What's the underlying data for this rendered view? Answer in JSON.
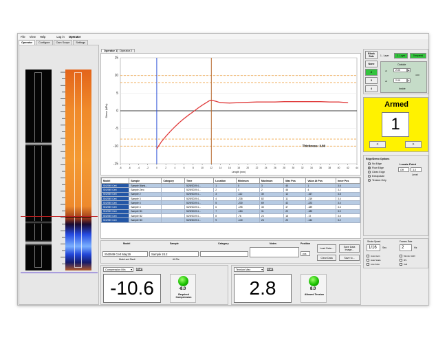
{
  "menu": [
    "File",
    "View",
    "Help",
    "Log in",
    "Operator"
  ],
  "tabs": [
    "Operator",
    "Configure",
    "Cam Scope",
    "Settings"
  ],
  "chart_tabs": [
    "Operator 1",
    "Operator 2"
  ],
  "chart_data": {
    "type": "line",
    "x_ticks": [
      "-8",
      "-6",
      "-4",
      "-2",
      "0",
      "2",
      "4",
      "6",
      "8",
      "10",
      "12",
      "14",
      "16",
      "18",
      "20",
      "22",
      "24",
      "26",
      "28",
      "30",
      "32",
      "34",
      "36",
      "38",
      "40",
      "42",
      "44"
    ],
    "y_ticks": [
      "15",
      "10",
      "5",
      "0",
      "-5",
      "-10",
      "-15"
    ],
    "xlim": [
      -8,
      44
    ],
    "ylim": [
      -15,
      15
    ],
    "ylabel": "Stress (MPa)",
    "xlabel": "Length (mm)",
    "annotation": "Thickness: 3.80",
    "series": [
      {
        "x": [
          0,
          1,
          2,
          3,
          4,
          5,
          6,
          7,
          8,
          9,
          10,
          11,
          11.5,
          12,
          13,
          14,
          16,
          18,
          20,
          22,
          24,
          26,
          28,
          30,
          32,
          34,
          36,
          38,
          40,
          42
        ],
        "y": [
          -10.8,
          -8.8,
          -7.2,
          -5.8,
          -4.5,
          -3.3,
          -2.2,
          -1.2,
          -0.3,
          0.7,
          1.6,
          2.4,
          2.8,
          3.0,
          2.7,
          2.3,
          2.2,
          2.3,
          2.4,
          2.5,
          2.5,
          2.5,
          2.6,
          2.6,
          2.6,
          2.6,
          2.6,
          2.5,
          2.5,
          2.3
        ]
      }
    ],
    "vlines": [
      {
        "x": 0,
        "color": "#2b4fd6"
      },
      {
        "x": 12,
        "color": "#b5672a"
      }
    ],
    "hlines_dashed": [
      {
        "y": 8,
        "color": "#f0a64a"
      },
      {
        "y": 10,
        "color": "#f0a64a"
      },
      {
        "y": -8,
        "color": "#f0a64a"
      },
      {
        "y": -10,
        "color": "#f0a64a"
      }
    ],
    "hline_zero": {
      "y": 0,
      "color": "#000000"
    },
    "line_color": "#e03b3b"
  },
  "table": {
    "columns": [
      "Model",
      "Sample",
      "Category",
      "Time",
      "Location",
      "Minimum",
      "Maximum",
      "Max Pos",
      "Value At Pos",
      "Inner Pos"
    ],
    "rows": [
      [
        "SN2949 Cert",
        "Sample Blank...",
        "",
        "5/29/2019 4...",
        "1",
        "0",
        "3",
        "40",
        "1",
        "3.6"
      ],
      [
        "SN2949 Cert",
        "Sample Zero",
        "",
        "5/29/2019 4...",
        "2",
        "4",
        "2",
        "46",
        "4",
        "3.2"
      ],
      [
        "SN2949 Cert",
        "Sample 2",
        "",
        "5/29/2019 4...",
        "3",
        "-112",
        "30",
        "12",
        "-167",
        "3.8"
      ],
      [
        "SN2949 Cert",
        "Sample 3",
        "",
        "5/29/2019 4...",
        "4",
        "-235",
        "82",
        "11",
        "-219",
        "3.4"
      ],
      [
        "SN2949 Cert",
        "Sample 4",
        "",
        "5/29/2019 4...",
        "5",
        "-230",
        "69",
        "42",
        "-223",
        "3.4"
      ],
      [
        "SN2949 Cert",
        "Sample 4",
        "",
        "5/29/2019 4...",
        "6",
        "-195",
        "35",
        "47",
        "-189",
        "3.3"
      ],
      [
        "SN2949 Cert",
        "Sample B1",
        "",
        "5/29/2019 4...",
        "7",
        "-184",
        "31",
        "22",
        "-180",
        "3.0"
      ],
      [
        "SN2949 Cert",
        "Sample B2",
        "",
        "5/29/2019 4...",
        "8",
        "-76",
        "23",
        "18",
        "-72",
        "3.8"
      ],
      [
        "SN2949 Cert",
        "Sample B3",
        "",
        "5/29/2019 4...",
        "9",
        "-140",
        "26",
        "20",
        "-142",
        "3.2"
      ]
    ]
  },
  "entry": {
    "headers": [
      "Model",
      "Sample",
      "Category",
      "Notes",
      "Position"
    ],
    "model_value": "SN2949 Cert May19",
    "sample_value": "Sample 24.2",
    "sub_labels": [
      "Model and Sizeit",
      "Alt File"
    ],
    "position_value": "pos",
    "buttons": [
      "Load Data...",
      "Save Data Image...",
      "Clear Data",
      "Save to..."
    ]
  },
  "compression": {
    "select": "Compression Min",
    "unit": "MPa",
    "value": "-10.6",
    "required_value": "-8.0",
    "required_label": "Required Compression"
  },
  "tension": {
    "select": "Tension Max",
    "unit": "MPa",
    "value": "2.8",
    "allowed_value": "8.0",
    "allowed_label": "Allowed Tension"
  },
  "block_side": {
    "header": "Block Side",
    "items": [
      "None",
      "2",
      "3",
      "4"
    ],
    "layers": [
      "1 - Layer",
      "2 - Layer",
      "Tempered"
    ]
  },
  "outside_inside": {
    "outside_label": "Outside",
    "inside_label": "Inside",
    "outside_value": "2.00",
    "inside_value": "2.00",
    "side_labels": [
      "x1",
      "x2"
    ],
    "total_value": "4.00"
  },
  "armed": {
    "title": "Armed",
    "number": "1",
    "prev": "<",
    "next": ">"
  },
  "edge": {
    "title": "Edge/Demo Options",
    "options": [
      "No Edge",
      "Flow Edge",
      "Clean Edge",
      "Extrapolate",
      "Tension Only"
    ],
    "selected": 1,
    "locate_title": "Locate Point",
    "locate_mode": "Off",
    "locate_value": "3.0",
    "level_label": "Level"
  },
  "bottom_right": {
    "stroke_label": "Stroke Speed",
    "stroke_value": "1/16",
    "stroke_unit": "Sec",
    "frames_label": "Frames Rate",
    "frames_value": "2",
    "frames_unit": "Hz",
    "checks_left": [
      "Auto-Gain",
      "Auto Scale",
      "Line Folio"
    ],
    "checks_right": [
      "Monitor LED",
      "RS",
      "Cell"
    ]
  },
  "colors": {
    "armed_bg": "#fff200",
    "block_selected": "#33c33d",
    "row_alt": "#b7cbe3",
    "selected_row": "#2457a6"
  }
}
